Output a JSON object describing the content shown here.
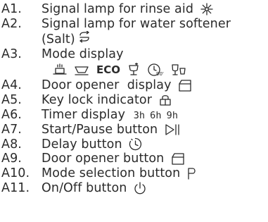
{
  "items": [
    {
      "num": "A1.",
      "label": "Signal lamp for rinse aid",
      "icon": "sparkle-icon"
    },
    {
      "num": "A2.",
      "label": "Signal lamp for water softener",
      "label2": "(Salt)",
      "icon": "salt-regen-icon"
    },
    {
      "num": "A3.",
      "label": "Mode display",
      "modes": [
        "auto-icon",
        "intensive-icon",
        "ECO",
        "glass-icon",
        "quick-90-icon",
        "rinse-icon"
      ]
    },
    {
      "num": "A4.",
      "label": "Door opener  display",
      "icon": "door-opener-icon"
    },
    {
      "num": "A5.",
      "label": "Key lock indicator",
      "icon": "lock-icon"
    },
    {
      "num": "A6.",
      "label": "Timer display",
      "timers": [
        "3h",
        "6h",
        "9h"
      ]
    },
    {
      "num": "A7.",
      "label": "Start/Pause button",
      "icon": "start-pause-icon"
    },
    {
      "num": "A8.",
      "label": "Delay button",
      "icon": "delay-clock-icon"
    },
    {
      "num": "A9.",
      "label": "Door opener button",
      "icon": "door-opener-icon"
    },
    {
      "num": "A10.",
      "label": "Mode selection button",
      "icon": "mode-p-icon"
    },
    {
      "num": "A11.",
      "label": "On/Off button",
      "icon": "power-icon"
    }
  ]
}
